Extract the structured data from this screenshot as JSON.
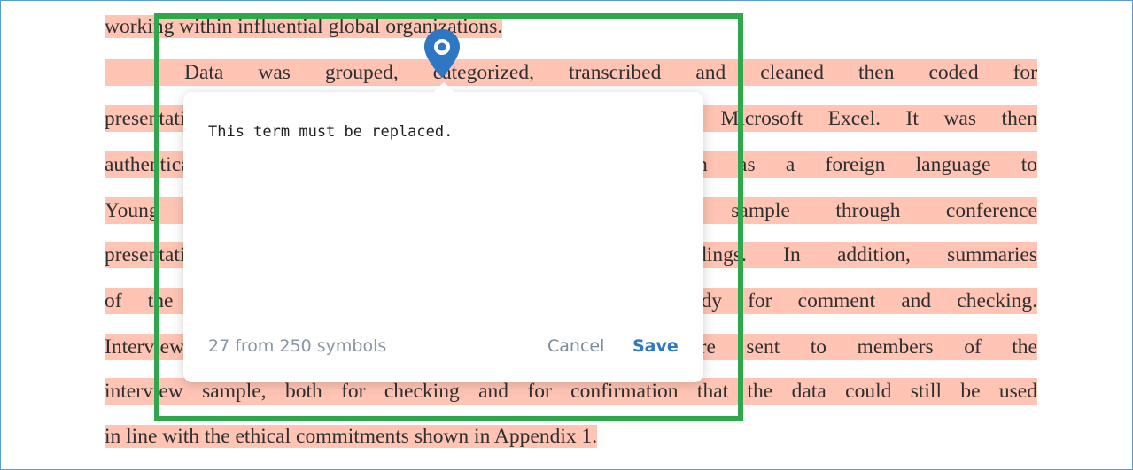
{
  "document": {
    "lines": [
      "working within influential global organizations.",
      "Data was grouped, categorized, transcribed and cleaned then coded for",
      "presentation to the respondents in a data table using Microsoft Excel. It was then",
      "authenticated by a teacher and translator of English as a foreign language to",
      "Young Professionals drawn from the research sample through conference",
      "presentations of the preliminary study results findings. In addition, summaries",
      "of the findings were sent to participants in the study for comment and checking.",
      "Interview transcripts and the preliminary findings were sent to members of the",
      "interview sample, both for checking and for confirmation that the data could still be used",
      "in line with the ethical commitments shown in Appendix 1."
    ]
  },
  "comment": {
    "text": "This term must be replaced.",
    "counter": "27 from 250 symbols",
    "cancel_label": "Cancel",
    "save_label": "Save"
  },
  "colors": {
    "highlight": "#ffc4b4",
    "selection_border": "#2ea84a",
    "pin": "#2e78c3",
    "save": "#2e78c3"
  },
  "icons": {
    "pin": "map-pin-icon"
  }
}
